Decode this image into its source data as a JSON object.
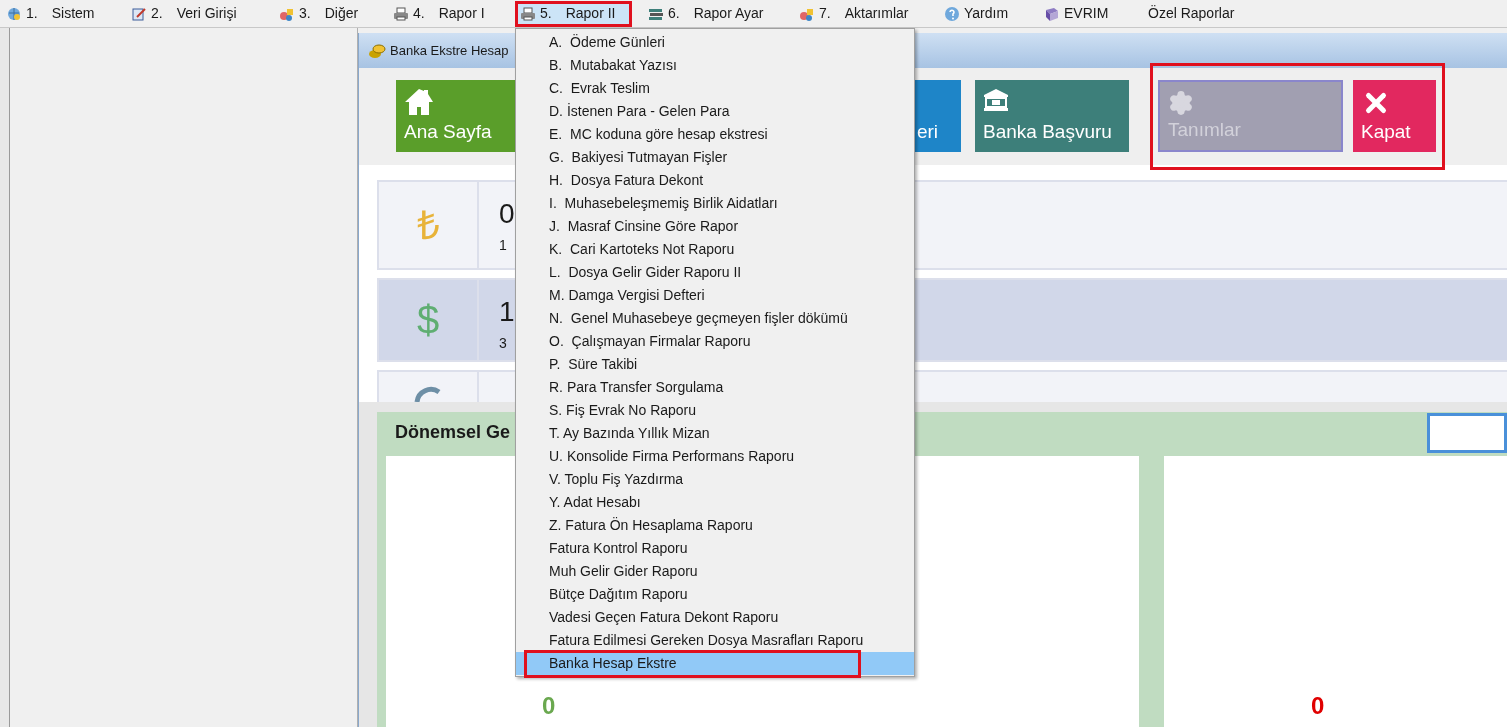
{
  "menubar": [
    {
      "number": "1.",
      "label": "Sistem",
      "selected": false,
      "highlighted": false
    },
    {
      "number": "2.",
      "label": "Veri Girişi",
      "selected": false,
      "highlighted": false
    },
    {
      "number": "3.",
      "label": "Diğer",
      "selected": false,
      "highlighted": false
    },
    {
      "number": "4.",
      "label": "Rapor I",
      "selected": false,
      "highlighted": false
    },
    {
      "number": "5.",
      "label": "Rapor II",
      "selected": true,
      "highlighted": true
    },
    {
      "number": "6.",
      "label": "Rapor Ayar",
      "selected": false,
      "highlighted": false
    },
    {
      "number": "7.",
      "label": "Aktarımlar",
      "selected": false,
      "highlighted": false
    },
    {
      "label": "Yardım",
      "selected": false,
      "highlighted": false
    },
    {
      "label": "EVRIM",
      "selected": false,
      "highlighted": false
    },
    {
      "label": "Özel Raporlar",
      "selected": false,
      "highlighted": false
    }
  ],
  "dropdown": {
    "items": [
      {
        "label": "A.  Ödeme Günleri",
        "selected": false,
        "highlighted": false
      },
      {
        "label": "B.  Mutabakat Yazısı",
        "selected": false,
        "highlighted": false
      },
      {
        "label": "C.  Evrak Teslim",
        "selected": false,
        "highlighted": false
      },
      {
        "label": "D. İstenen Para - Gelen Para",
        "selected": false,
        "highlighted": false
      },
      {
        "label": "E.  MC koduna göre hesap ekstresi",
        "selected": false,
        "highlighted": false
      },
      {
        "label": "G.  Bakiyesi Tutmayan Fişler",
        "selected": false,
        "highlighted": false
      },
      {
        "label": "H.  Dosya Fatura Dekont",
        "selected": false,
        "highlighted": false
      },
      {
        "label": "I.  Muhasebeleşmemiş Birlik Aidatları",
        "selected": false,
        "highlighted": false
      },
      {
        "label": "J.  Masraf Cinsine Göre Rapor",
        "selected": false,
        "highlighted": false
      },
      {
        "label": "K.  Cari Kartoteks Not Raporu",
        "selected": false,
        "highlighted": false
      },
      {
        "label": "L.  Dosya Gelir Gider Raporu II",
        "selected": false,
        "highlighted": false
      },
      {
        "label": "M. Damga Vergisi Defteri",
        "selected": false,
        "highlighted": false
      },
      {
        "label": "N.  Genel Muhasebeye geçmeyen fişler dökümü",
        "selected": false,
        "highlighted": false
      },
      {
        "label": "O.  Çalışmayan Firmalar Raporu",
        "selected": false,
        "highlighted": false
      },
      {
        "label": "P.  Süre Takibi",
        "selected": false,
        "highlighted": false
      },
      {
        "label": "R. Para Transfer Sorgulama",
        "selected": false,
        "highlighted": false
      },
      {
        "label": "S. Fiş Evrak No Raporu",
        "selected": false,
        "highlighted": false
      },
      {
        "label": "T. Ay Bazında Yıllık Mizan",
        "selected": false,
        "highlighted": false
      },
      {
        "label": "U. Konsolide Firma Performans Raporu",
        "selected": false,
        "highlighted": false
      },
      {
        "label": "V. Toplu Fiş Yazdırma",
        "selected": false,
        "highlighted": false
      },
      {
        "label": "Y. Adat Hesabı",
        "selected": false,
        "highlighted": false
      },
      {
        "label": "Z. Fatura Ön Hesaplama Raporu",
        "selected": false,
        "highlighted": false
      },
      {
        "label": "Fatura Kontrol Raporu",
        "selected": false,
        "highlighted": false
      },
      {
        "label": "Muh Gelir Gider Raporu",
        "selected": false,
        "highlighted": false
      },
      {
        "label": "Bütçe Dağıtım Raporu",
        "selected": false,
        "highlighted": false
      },
      {
        "label": "Vadesi Geçen Fatura Dekont Raporu",
        "selected": false,
        "highlighted": false
      },
      {
        "label": "Fatura Edilmesi Gereken Dosya Masrafları Raporu",
        "selected": false,
        "highlighted": false
      },
      {
        "label": "Banka Hesap Ekstre",
        "selected": true,
        "highlighted": true
      }
    ]
  },
  "window": {
    "title": "Banka Ekstre Hesap"
  },
  "toolbar": [
    {
      "label": "Ana Sayfa",
      "color": "#5a9e2a",
      "disabled": false,
      "highlighted": false
    },
    {
      "label": "eri",
      "color": "#1e85c8",
      "disabled": false,
      "highlighted": false
    },
    {
      "label": "Banka Başvuru",
      "color": "#3d7f7a",
      "disabled": false,
      "highlighted": false
    },
    {
      "label": "Tanımlar",
      "color": "#a19fb1",
      "disabled": true,
      "highlighted": true
    },
    {
      "label": "Kapat",
      "color": "#e2285f",
      "disabled": false,
      "highlighted": true
    }
  ],
  "cards": [
    {
      "kind": "lira",
      "symbol": "₺",
      "value": "0",
      "note": "1",
      "selected": false
    },
    {
      "kind": "dollar",
      "symbol": "$",
      "value": "1",
      "note": "3",
      "selected": true
    },
    {
      "kind": "euro",
      "selected": false
    }
  ],
  "period_panel": {
    "title": "Dönemsel Ge",
    "panels": [
      {
        "value": "0",
        "color": "#6aa84f"
      },
      {
        "value": "0",
        "color": "#e00000"
      }
    ]
  }
}
